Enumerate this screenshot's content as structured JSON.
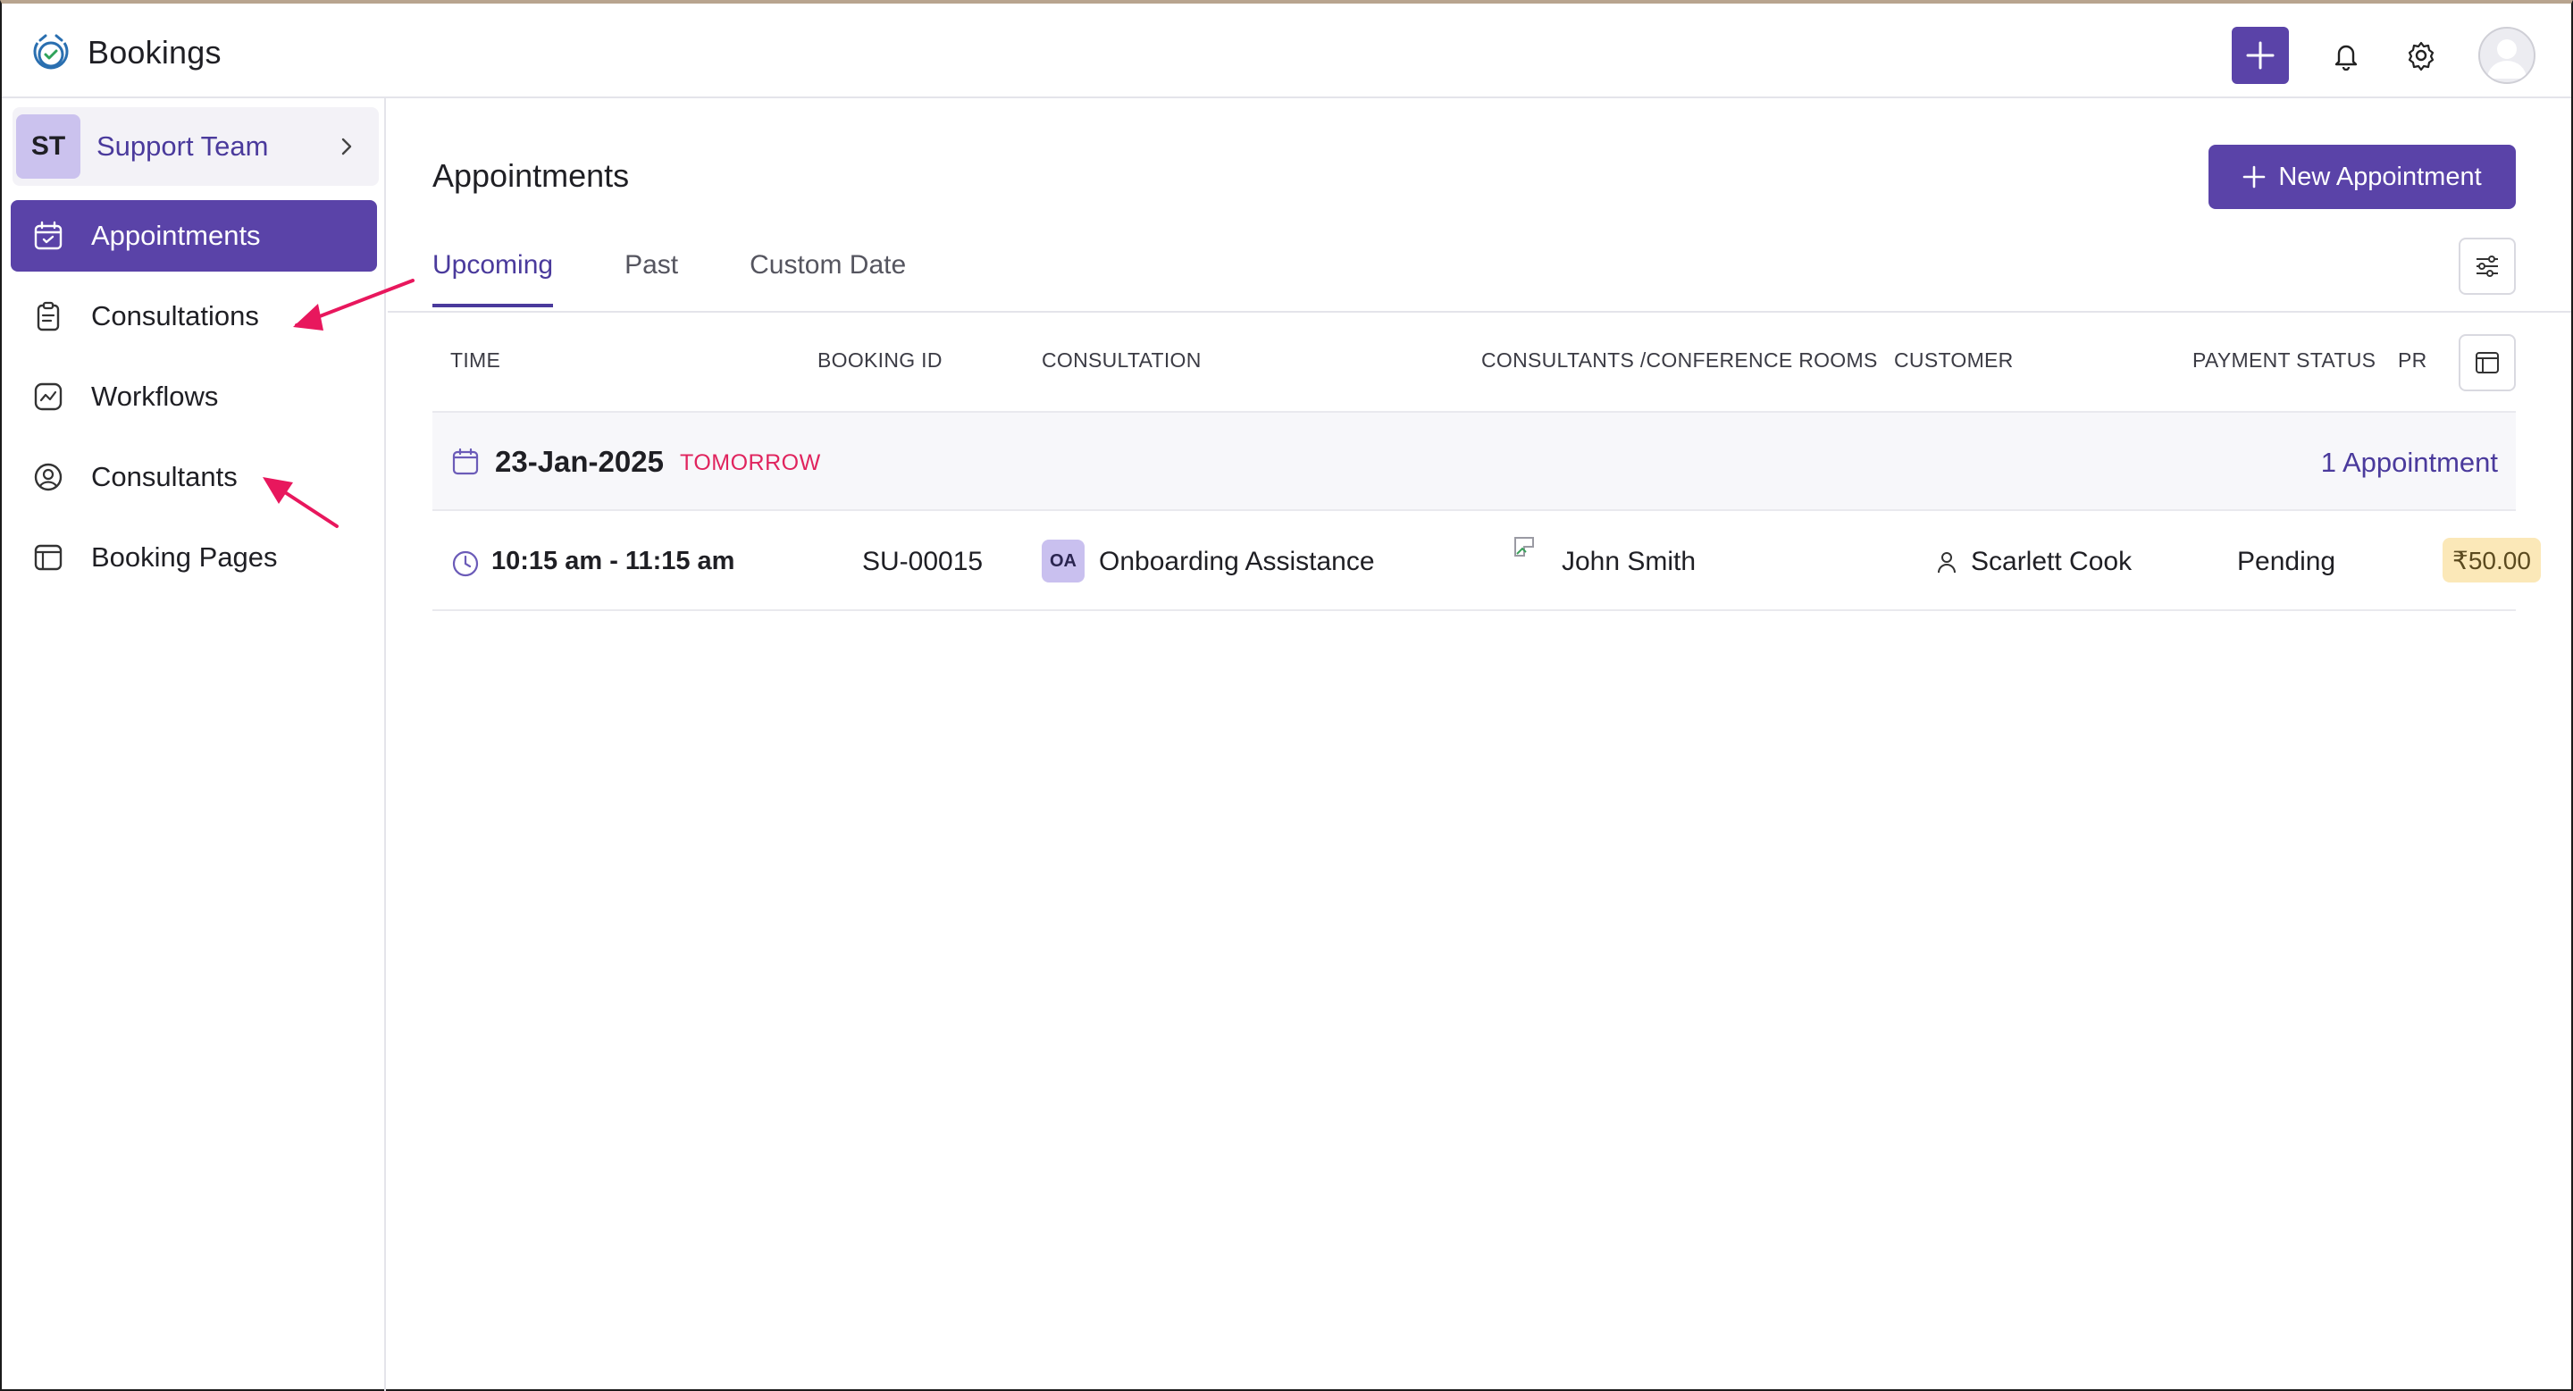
{
  "app": {
    "title": "Bookings"
  },
  "header": {
    "add_icon": "plus-icon",
    "notification_icon": "bell-icon",
    "settings_icon": "gear-icon",
    "avatar_icon": "user-avatar-icon"
  },
  "sidebar": {
    "team": {
      "initials": "ST",
      "name": "Support Team"
    },
    "items": [
      {
        "label": "Appointments",
        "icon": "calendar-check-icon",
        "active": true
      },
      {
        "label": "Consultations",
        "icon": "clipboard-icon",
        "active": false
      },
      {
        "label": "Workflows",
        "icon": "workflow-icon",
        "active": false
      },
      {
        "label": "Consultants",
        "icon": "user-circle-icon",
        "active": false
      },
      {
        "label": "Booking Pages",
        "icon": "booking-page-icon",
        "active": false
      }
    ]
  },
  "main": {
    "title": "Appointments",
    "new_button_label": "New Appointment",
    "tabs": [
      {
        "label": "Upcoming",
        "active": true
      },
      {
        "label": "Past",
        "active": false
      },
      {
        "label": "Custom Date",
        "active": false
      }
    ],
    "columns": [
      "TIME",
      "BOOKING ID",
      "CONSULTATION",
      "CONSULTANTS /CONFERENCE ROOMS",
      "CUSTOMER",
      "PAYMENT STATUS",
      "PR"
    ],
    "groups": [
      {
        "date": "23-Jan-2025",
        "tag": "TOMORROW",
        "count_label": "1 Appointment",
        "rows": [
          {
            "time": "10:15 am - 11:15 am",
            "booking_id": "SU-00015",
            "consultation_initials": "OA",
            "consultation": "Onboarding Assistance",
            "consultant": "John Smith",
            "customer": "Scarlett Cook",
            "payment_status": "Pending",
            "price": "₹50.00"
          }
        ]
      }
    ]
  },
  "colors": {
    "accent": "#5a43a8",
    "accent_text": "#4a3a9c",
    "tag_red": "#e0245e",
    "price_bg": "#fbe8b8",
    "annotation_arrow": "#e8175d"
  }
}
